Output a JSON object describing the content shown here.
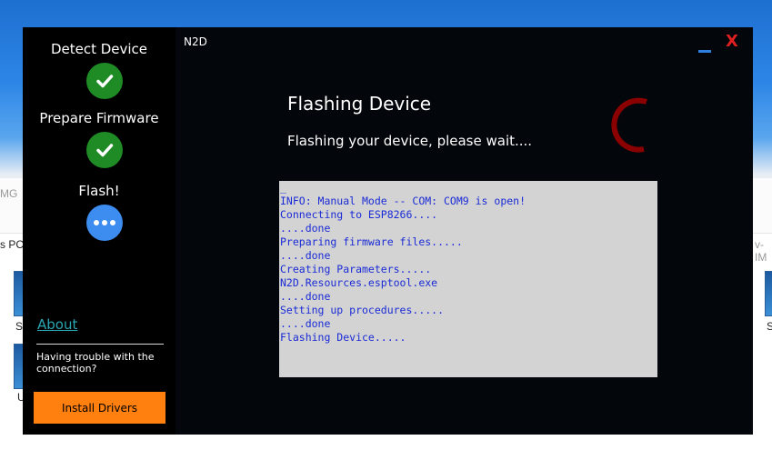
{
  "background": {
    "left_fragments": [
      "MG",
      "s PC",
      "Se",
      "U"
    ],
    "right_fragments": [
      "v-IM",
      "S"
    ]
  },
  "sidebar": {
    "steps": [
      {
        "label": "Detect Device",
        "state": "done"
      },
      {
        "label": "Prepare Firmware",
        "state": "done"
      },
      {
        "label": "Flash!",
        "state": "active"
      }
    ],
    "about_label": "About",
    "trouble_text": "Having trouble with the connection?",
    "install_label": "Install Drivers"
  },
  "window": {
    "title": "N2D",
    "close_label": "X",
    "minimize_label": "_"
  },
  "main": {
    "heading": "Flashing Device",
    "subheading": "Flashing your device, please wait....",
    "console_lines": [
      "_",
      "INFO: Manual Mode -- COM: COM9 is open!",
      "Connecting to ESP8266....",
      "....done",
      "Preparing firmware files.....",
      "....done",
      "Creating Parameters.....",
      "N2D.Resources.esptool.exe",
      "....done",
      "Setting up procedures.....",
      "....done",
      "Flashing Device....."
    ]
  },
  "colors": {
    "done": "#1f8b25",
    "active": "#3d8cf0",
    "accent_orange": "#ff7f0f",
    "console_text": "#1a2bd6",
    "spinner": "#8b0000",
    "close_red": "#e02020"
  },
  "icons": {
    "done": "check-icon",
    "active": "dots-icon",
    "busy": "spinner-icon"
  }
}
